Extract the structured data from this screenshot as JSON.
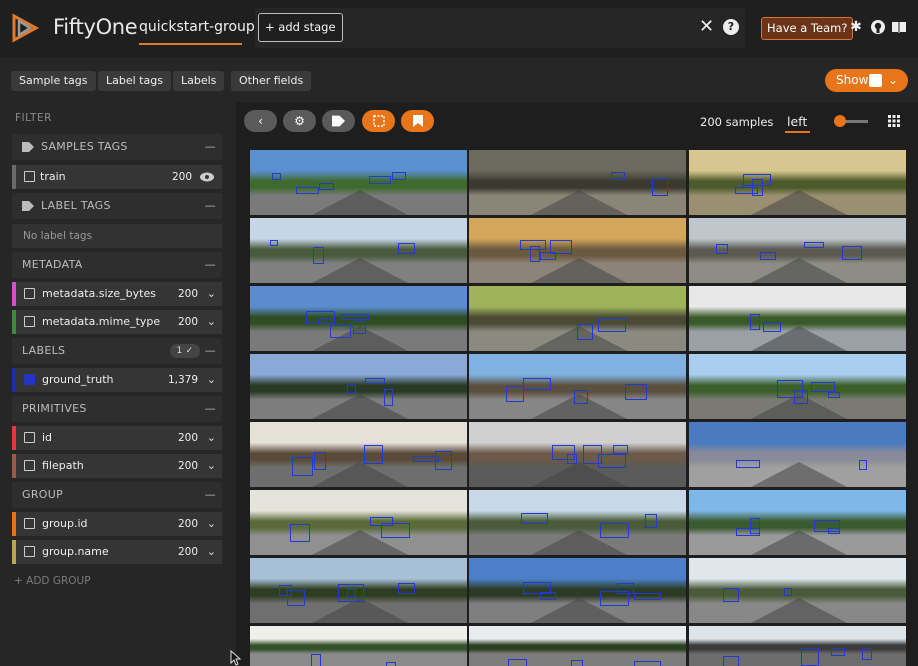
{
  "header": {
    "brand": "FiftyOne",
    "dataset": "quickstart-groups",
    "add_stage": "+ add stage",
    "team_button": "Have a Team?",
    "icons": [
      "close-icon",
      "help-icon",
      "slack-icon",
      "github-icon",
      "docs-icon"
    ]
  },
  "tabs": [
    "Sample tags",
    "Label tags",
    "Labels",
    "Other fields"
  ],
  "show_button": "Show",
  "sidebar": {
    "filter_title": "FILTER",
    "sample_tags_title": "SAMPLES TAGS",
    "train": {
      "label": "train",
      "count": "200"
    },
    "label_tags_title": "LABEL TAGS",
    "no_label_tags": "No label tags",
    "metadata_title": "METADATA",
    "metadata_rows": [
      {
        "label": "metadata.size_bytes",
        "count": "200",
        "color": "#d44fd0"
      },
      {
        "label": "metadata.mime_type",
        "count": "200",
        "color": "#3f8a3a"
      }
    ],
    "labels_title": "LABELS",
    "labels_badge": "1 ✓",
    "labels_rows": [
      {
        "label": "ground_truth",
        "count": "1,379",
        "color": "#1f2fa8",
        "checked": true
      }
    ],
    "primitives_title": "PRIMITIVES",
    "primitive_rows": [
      {
        "label": "id",
        "count": "200",
        "color": "#e23a3a"
      },
      {
        "label": "filepath",
        "count": "200",
        "color": "#9a5a45"
      }
    ],
    "group_title": "GROUP",
    "group_rows": [
      {
        "label": "group.id",
        "count": "200",
        "color": "#e8751a"
      },
      {
        "label": "group.name",
        "count": "200",
        "color": "#b8a84a"
      }
    ],
    "add_group": "+ ADD GROUP"
  },
  "main": {
    "sample_count": "200 samples",
    "group_slice": "left",
    "tiles": 24
  },
  "colors": {
    "accent": "#e8751a",
    "box": "#1f3bd6"
  }
}
